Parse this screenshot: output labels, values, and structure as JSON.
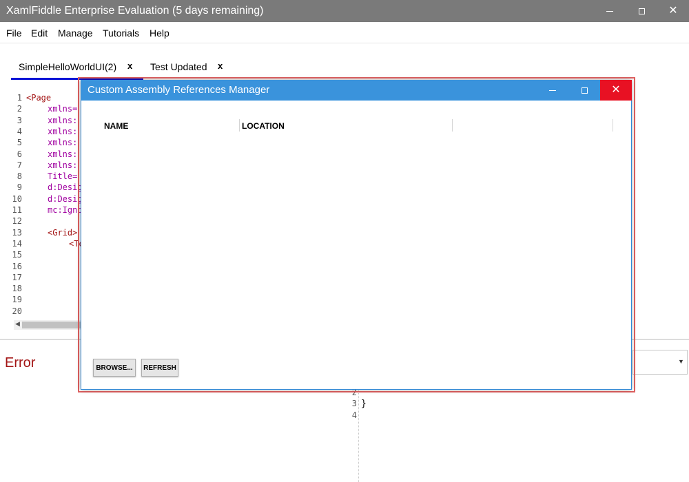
{
  "app": {
    "title": "XamlFiddle Enterprise Evaluation (5 days remaining)",
    "close_glyph": "✕"
  },
  "menu": [
    "File",
    "Edit",
    "Manage",
    "Tutorials",
    "Help"
  ],
  "tabs": [
    {
      "label": "SimpleHelloWorldUI(2)",
      "close": "x",
      "active": true
    },
    {
      "label": "Test Updated",
      "close": "x",
      "active": false
    }
  ],
  "editor": {
    "line_numbers": [
      "1",
      "2",
      "3",
      "4",
      "5",
      "6",
      "7",
      "8",
      "9",
      "10",
      "11",
      "12",
      "13",
      "14",
      "15",
      "16",
      "17",
      "18",
      "19",
      "20"
    ],
    "lines": [
      {
        "n": 1,
        "text": "<Page",
        "kind": "tag",
        "indent": 0
      },
      {
        "n": 2,
        "text": "xmlns=",
        "kind": "attr",
        "indent": 1
      },
      {
        "n": 3,
        "text": "xmlns:",
        "kind": "attr",
        "indent": 1
      },
      {
        "n": 4,
        "text": "xmlns:",
        "kind": "attr",
        "indent": 1
      },
      {
        "n": 5,
        "text": "xmlns:",
        "kind": "attr",
        "indent": 1
      },
      {
        "n": 6,
        "text": "xmlns:",
        "kind": "attr",
        "indent": 1
      },
      {
        "n": 7,
        "text": "xmlns:",
        "kind": "attr",
        "indent": 1
      },
      {
        "n": 8,
        "text": "Title=",
        "kind": "attr",
        "indent": 1
      },
      {
        "n": 9,
        "text": "d:Desig",
        "kind": "attr",
        "indent": 1
      },
      {
        "n": 10,
        "text": "d:Desig",
        "kind": "attr",
        "indent": 1
      },
      {
        "n": 11,
        "text": "mc:Igno",
        "kind": "attr",
        "indent": 1
      },
      {
        "n": 13,
        "text": "<Grid>",
        "kind": "tag",
        "indent": 1
      },
      {
        "n": 14,
        "text": "<Te",
        "kind": "tag",
        "indent": 2
      }
    ]
  },
  "bottom": {
    "error_label": "Error",
    "line_numbers": [
      "2",
      "3",
      "4"
    ],
    "code_line_3": "}"
  },
  "dialog": {
    "title": "Custom Assembly References Manager",
    "close_glyph": "✕",
    "columns": [
      "NAME",
      "LOCATION"
    ],
    "buttons": {
      "browse": "BROWSE...",
      "refresh": "REFRESH"
    }
  },
  "colors": {
    "main_titlebar": "#7a7a7a",
    "dialog_titlebar": "#3a93dc",
    "dialog_close": "#e81123",
    "error": "#a31515",
    "active_tab_underline": "#0a14d6"
  }
}
